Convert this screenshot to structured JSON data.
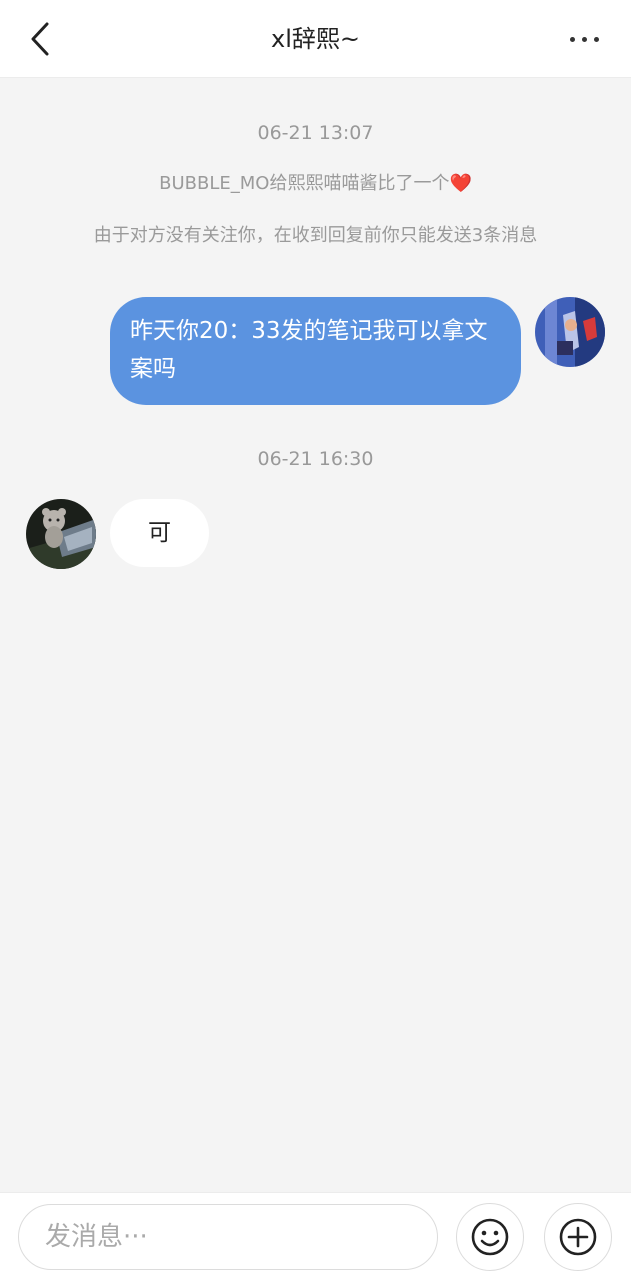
{
  "header": {
    "title": "xl辞熙~",
    "back_icon": "chevron-left-icon",
    "more_icon": "more-horizontal-icon"
  },
  "conversation": {
    "timestamp_1": "06-21 13:07",
    "system_1_prefix": "BUBBLE_MO给熙熙喵喵酱比了一个",
    "system_1_heart": "❤️",
    "system_2": "由于对方没有关注你，在收到回复前你只能发送3条消息",
    "message_self": "昨天你20：33发的笔记我可以拿文案吗",
    "timestamp_2": "06-21 16:30",
    "message_other": "可"
  },
  "composer": {
    "placeholder": "发消息···",
    "emoji_icon": "smiley-icon",
    "plus_icon": "plus-circle-icon"
  },
  "colors": {
    "self_bubble": "#5b93e0",
    "background": "#f4f4f4",
    "heart": "#e0262e"
  }
}
